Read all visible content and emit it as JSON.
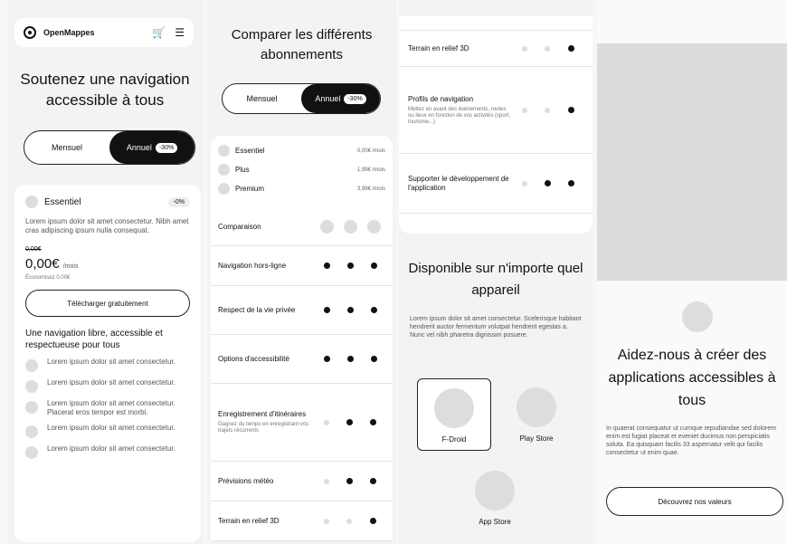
{
  "brand": {
    "name": "OpenMappes"
  },
  "hero": {
    "title": "Soutenez une navigation accessible à tous"
  },
  "billing": {
    "monthly": "Mensuel",
    "yearly": "Annuel",
    "discount": "-30%"
  },
  "plan_card": {
    "name": "Essentiel",
    "chip": "-0%",
    "description": "Lorem ipsum dolor sit amet consectetur. Nibh amet cras adipiscing ipsum nulla consequat.",
    "old_price": "0,00€",
    "price": "0,00€",
    "price_unit": "/mois",
    "saving": "Économisez 0,00€",
    "cta": "Télécharger gratuitement",
    "features_title": "Une navigation libre, accessible et respectueuse pour tous",
    "features": [
      "Lorem ipsum dolor sit amet consectetur.",
      "Lorem ipsum dolor sit amet consectetur.",
      "Lorem ipsum dolor sit amet consectetur. Placerat eros tempor est morbi.",
      "Lorem ipsum dolor sit amet consectetur.",
      "Lorem ipsum dolor sit amet consectetur."
    ]
  },
  "compare": {
    "title": "Comparer les différents abonnements",
    "plans": [
      {
        "name": "Essentiel",
        "price": "0,00€ /mois"
      },
      {
        "name": "Plus",
        "price": "1,99€ /mois"
      },
      {
        "name": "Premium",
        "price": "3,99€ /mois"
      }
    ],
    "header_label": "Comparaison",
    "rows": [
      {
        "label": "Navigation hors-ligne",
        "sub": "",
        "marks": [
          true,
          true,
          true
        ]
      },
      {
        "label": "Respect de la vie privée",
        "sub": "",
        "marks": [
          true,
          true,
          true
        ]
      },
      {
        "label": "Options d'accessibilité",
        "sub": "",
        "marks": [
          true,
          true,
          true
        ]
      },
      {
        "label": "Enregistrement d'itinéraires",
        "sub": "Gagnez du temps en enregistrant vos trajets récurrents",
        "marks": [
          false,
          true,
          true
        ]
      },
      {
        "label": "Prévisions météo",
        "sub": "",
        "marks": [
          false,
          true,
          true
        ]
      },
      {
        "label": "Terrain en relief 3D",
        "sub": "",
        "marks": [
          false,
          false,
          true
        ]
      }
    ],
    "rows_more": [
      {
        "label": "Terrain en relief 3D",
        "sub": "",
        "marks": [
          false,
          false,
          true
        ]
      },
      {
        "label": "Profils de navigation",
        "sub": "Mettez en avant des évènements, routes ou lieux en fonction de vos activités (sport, tourisme...)",
        "marks": [
          false,
          false,
          true
        ]
      },
      {
        "label": "Supporter le développement de l'application",
        "sub": "",
        "marks": [
          false,
          true,
          true
        ]
      }
    ]
  },
  "available": {
    "title": "Disponible sur n'importe quel appareil",
    "description": "Lorem ipsum dolor sit amet consectetur. Scelerisque habitant hendrerit auctor fermentum volutpat hendrerit egestas a. Nunc vel nibh pharetra dignissim posuere.",
    "stores": [
      "F-Droid",
      "Play Store",
      "App Store"
    ]
  },
  "help": {
    "title": "Aidez-nous à créer des applications accessibles à tous",
    "description": "In quaerat consequatur ut cumque repudiandae sed dolorem enim est fugiat placeat et eveniet ducimus non perspiciatis soluta. Ea quisquam facilis 33 aspernatur velit qui facilis consectetur ut enim quae.",
    "cta": "Découvrez nos valeurs"
  }
}
